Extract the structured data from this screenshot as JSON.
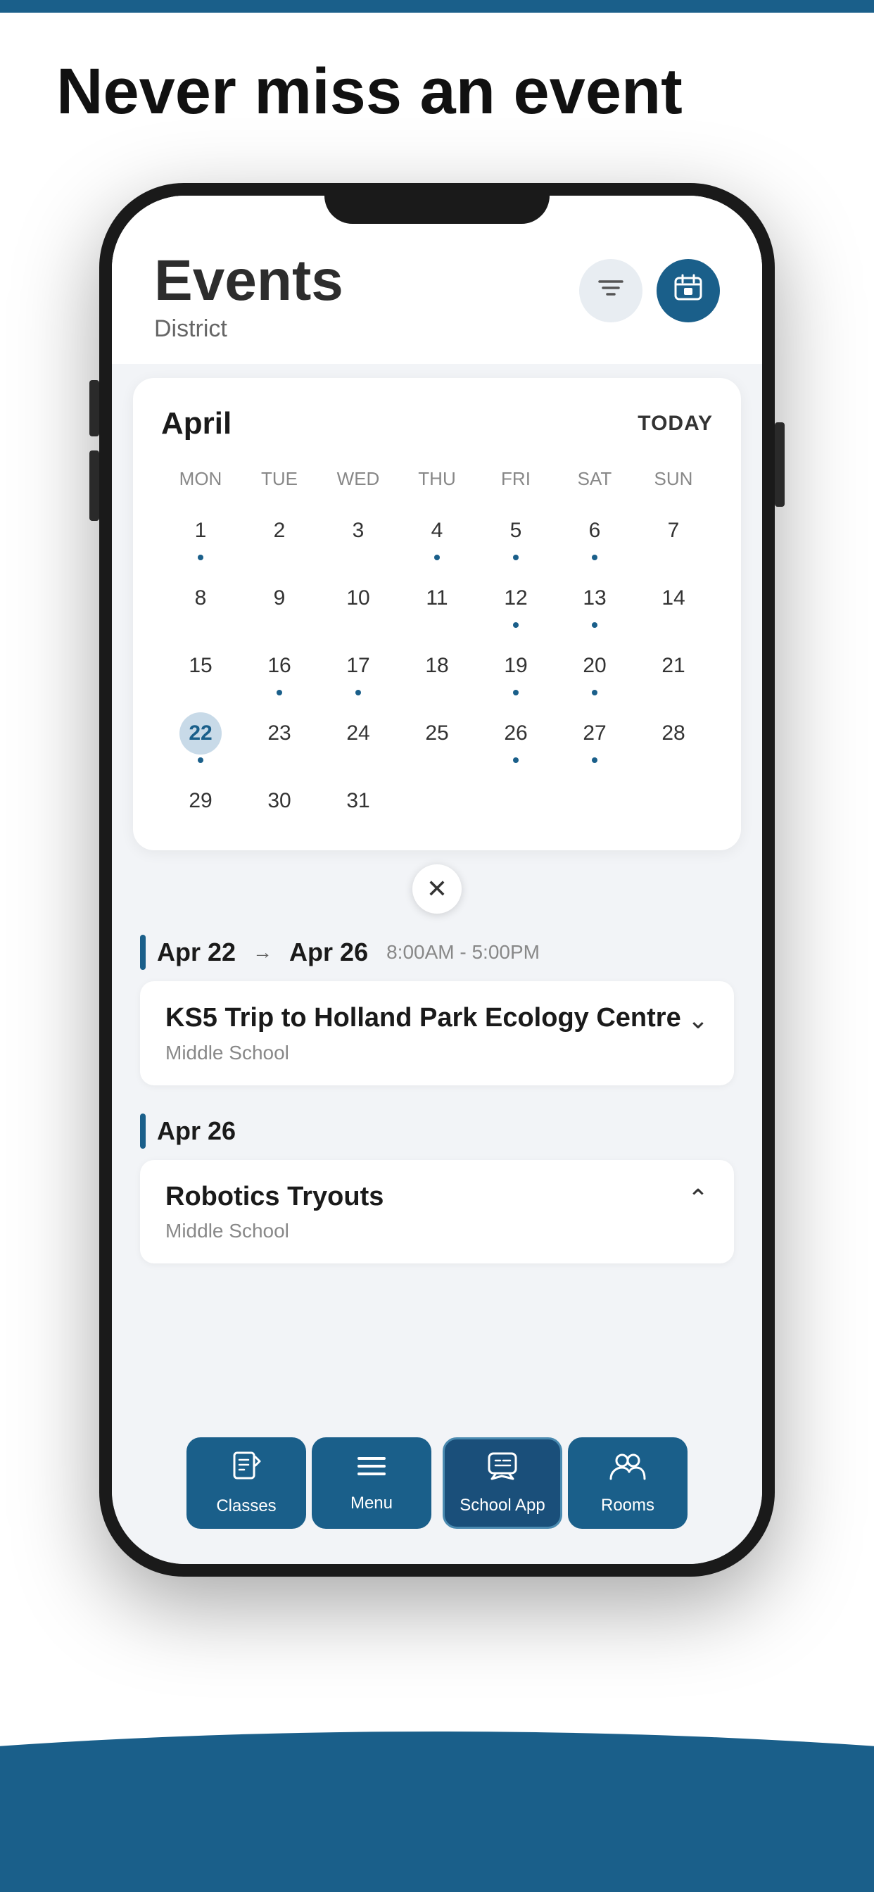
{
  "page": {
    "top_bar_color": "#1a5f8a",
    "heading": "Never miss an event"
  },
  "phone": {
    "screen": {
      "header": {
        "title": "Events",
        "subtitle": "District",
        "filter_btn_label": "filter",
        "calendar_btn_label": "calendar"
      },
      "calendar": {
        "month": "April",
        "today_label": "TODAY",
        "days_header": [
          "MON",
          "TUE",
          "WED",
          "THU",
          "FRI",
          "SAT",
          "SUN"
        ],
        "weeks": [
          [
            {
              "day": "1",
              "dot": true,
              "selected": false
            },
            {
              "day": "2",
              "dot": false,
              "selected": false
            },
            {
              "day": "3",
              "dot": false,
              "selected": false
            },
            {
              "day": "4",
              "dot": true,
              "selected": false
            },
            {
              "day": "5",
              "dot": true,
              "selected": false
            },
            {
              "day": "6",
              "dot": true,
              "selected": false
            },
            {
              "day": "7",
              "dot": false,
              "selected": false
            }
          ],
          [
            {
              "day": "8",
              "dot": false,
              "selected": false
            },
            {
              "day": "9",
              "dot": false,
              "selected": false
            },
            {
              "day": "10",
              "dot": false,
              "selected": false
            },
            {
              "day": "11",
              "dot": false,
              "selected": false
            },
            {
              "day": "12",
              "dot": true,
              "selected": false
            },
            {
              "day": "13",
              "dot": true,
              "selected": false
            },
            {
              "day": "14",
              "dot": false,
              "selected": false
            }
          ],
          [
            {
              "day": "15",
              "dot": false,
              "selected": false
            },
            {
              "day": "16",
              "dot": true,
              "selected": false
            },
            {
              "day": "17",
              "dot": true,
              "selected": false
            },
            {
              "day": "18",
              "dot": false,
              "selected": false
            },
            {
              "day": "19",
              "dot": true,
              "selected": false
            },
            {
              "day": "20",
              "dot": true,
              "selected": false
            },
            {
              "day": "21",
              "dot": false,
              "selected": false
            }
          ],
          [
            {
              "day": "22",
              "dot": true,
              "selected": true
            },
            {
              "day": "23",
              "dot": false,
              "selected": false
            },
            {
              "day": "24",
              "dot": false,
              "selected": false
            },
            {
              "day": "25",
              "dot": false,
              "selected": false
            },
            {
              "day": "26",
              "dot": true,
              "selected": false
            },
            {
              "day": "27",
              "dot": true,
              "selected": false
            },
            {
              "day": "28",
              "dot": false,
              "selected": false
            }
          ],
          [
            {
              "day": "29",
              "dot": false,
              "selected": false
            },
            {
              "day": "30",
              "dot": false,
              "selected": false
            },
            {
              "day": "31",
              "dot": false,
              "selected": false
            },
            {
              "day": "",
              "dot": false,
              "selected": false
            },
            {
              "day": "",
              "dot": false,
              "selected": false
            },
            {
              "day": "",
              "dot": false,
              "selected": false
            },
            {
              "day": "",
              "dot": false,
              "selected": false
            }
          ]
        ]
      },
      "events": [
        {
          "date_start": "Apr 22",
          "date_end": "Apr 26",
          "time": "8:00AM - 5:00PM",
          "has_range": true,
          "title": "KS5 Trip to Holland Park Ecology Centre",
          "school": "Middle School",
          "expanded": false,
          "chevron": "▾"
        },
        {
          "date_start": "Apr 26",
          "date_end": "",
          "time": "",
          "has_range": false,
          "title": "Robotics Tryouts",
          "school": "Middle School",
          "expanded": true,
          "chevron": "▴"
        }
      ],
      "bottom_nav": [
        {
          "label": "Classes",
          "icon": "📋",
          "active": false
        },
        {
          "label": "Menu",
          "icon": "☰",
          "active": false
        },
        {
          "label": "School App",
          "icon": "💬",
          "active": true
        },
        {
          "label": "Rooms",
          "icon": "👥",
          "active": false
        }
      ]
    }
  }
}
